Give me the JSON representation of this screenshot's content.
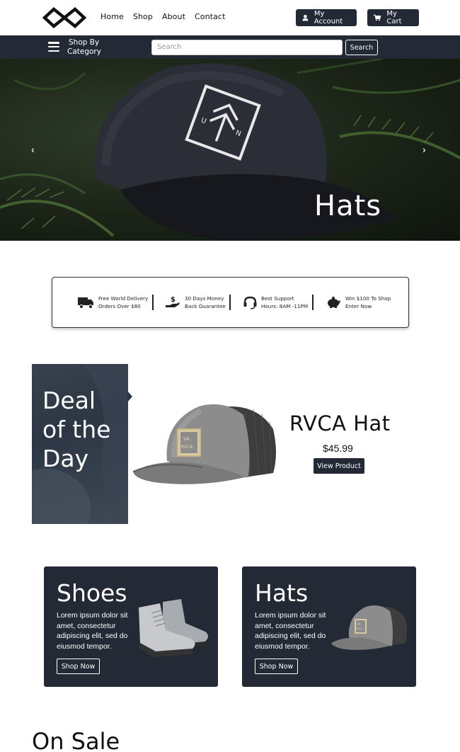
{
  "nav": {
    "links": [
      "Home",
      "Shop",
      "About",
      "Contact"
    ],
    "account_label": "My Account",
    "cart_label": "My Cart"
  },
  "catbar": {
    "shop_by_line1": "Shop By",
    "shop_by_line2": "Category",
    "search_placeholder": "Search",
    "search_button": "Search"
  },
  "hero": {
    "title": "Hats",
    "prev_arrow": "‹",
    "next_arrow": "›"
  },
  "features": [
    {
      "icon": "truck-icon",
      "line1": "Free World Delivery",
      "line2": "Orders Over $80"
    },
    {
      "icon": "money-hand-icon",
      "line1": "30 Days Money",
      "line2": "Back Guarantee"
    },
    {
      "icon": "headset-icon",
      "line1": "Best Support",
      "line2": "Hours: 8AM -11PM"
    },
    {
      "icon": "piggy-bank-icon",
      "line1": "Win $100 To Shop",
      "line2": "Enter Now"
    }
  ],
  "deal": {
    "title_line1": "Deal",
    "title_line2": "of the",
    "title_line3": "Day",
    "product_name": "RVCA Hat",
    "price": "$45.99",
    "button": "View Product"
  },
  "categories": [
    {
      "title": "Shoes",
      "text": "Lorem ipsum dolor sit amet, consectetur adipiscing elit, sed do eiusmod tempor.",
      "button": "Shop Now"
    },
    {
      "title": "Hats",
      "text": "Lorem ipsum dolor sit amet, consectetur adipiscing elit, sed do eiusmod tempor.",
      "button": "Shop Now"
    }
  ],
  "sections": {
    "on_sale": "On Sale"
  },
  "colors": {
    "primary_dark": "#232a36",
    "white": "#ffffff"
  }
}
